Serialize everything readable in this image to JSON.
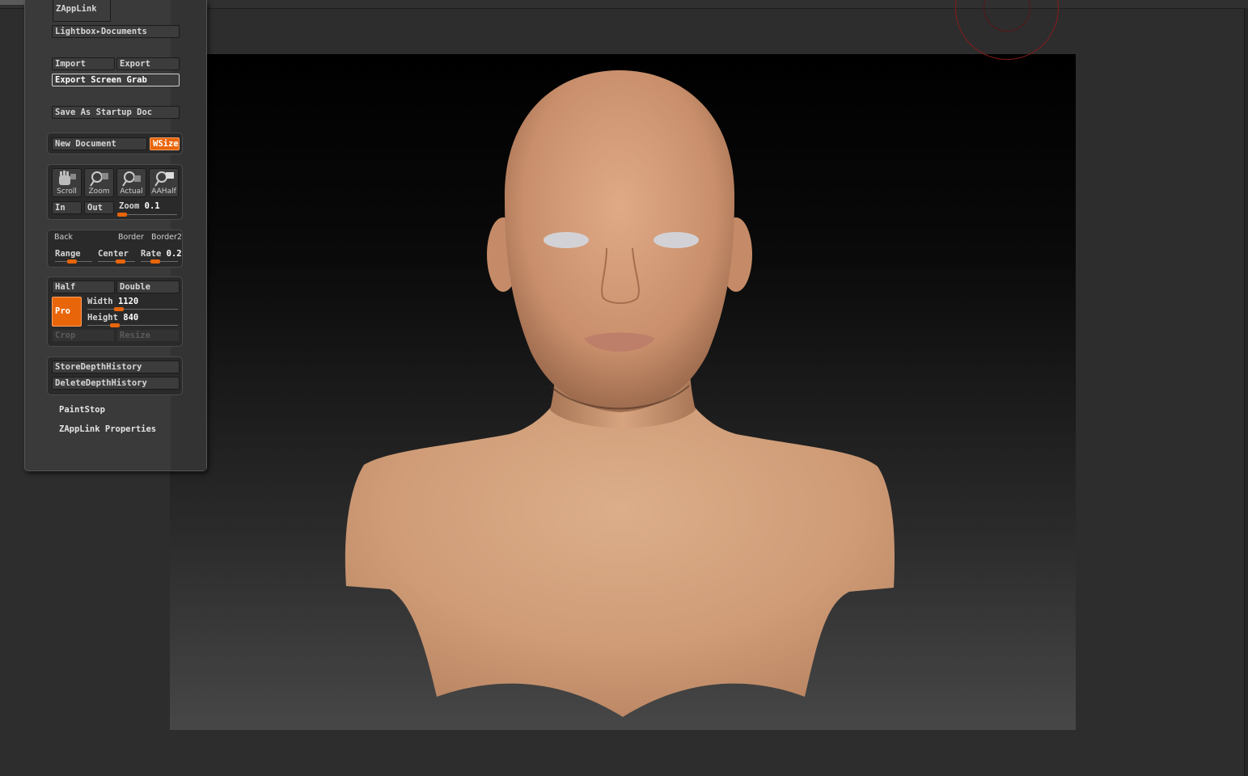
{
  "palette": {
    "zapplink": "ZAppLink",
    "lightbox": "Lightbox",
    "documents": "Documents",
    "import": "Import",
    "export": "Export",
    "export_screen_grab": "Export Screen Grab",
    "save_startup": "Save As Startup Doc",
    "new_document": "New Document",
    "wsize": "WSize",
    "nav": {
      "scroll": "Scroll",
      "zoom": "Zoom",
      "actual": "Actual",
      "aahalf": "AAHalf",
      "in": "In",
      "out": "Out",
      "zoom_slider_label": "Zoom",
      "zoom_value": "0.1",
      "zoom_fraction": 0.05
    },
    "back": {
      "back": "Back",
      "border": "Border",
      "border2": "Border2",
      "range": "Range",
      "center": "Center",
      "rate": "Rate",
      "rate_value": "0.2",
      "range_fraction": 0.45,
      "center_fraction": 0.6,
      "rate_fraction": 0.4
    },
    "size": {
      "half": "Half",
      "double": "Double",
      "pro": "Pro",
      "width_label": "Width",
      "width_value": "1120",
      "width_fraction": 0.35,
      "height_label": "Height",
      "height_value": "840",
      "height_fraction": 0.3,
      "crop": "Crop",
      "resize": "Resize"
    },
    "store_depth": "StoreDepthHistory",
    "delete_depth": "DeleteDepthHistory",
    "paintstop": "PaintStop",
    "zapplink_props": "ZAppLink Properties"
  },
  "colors": {
    "accent": "#e8650a",
    "canvas_top": "#000000",
    "canvas_bottom": "#474747",
    "skin": "#d39c78"
  }
}
